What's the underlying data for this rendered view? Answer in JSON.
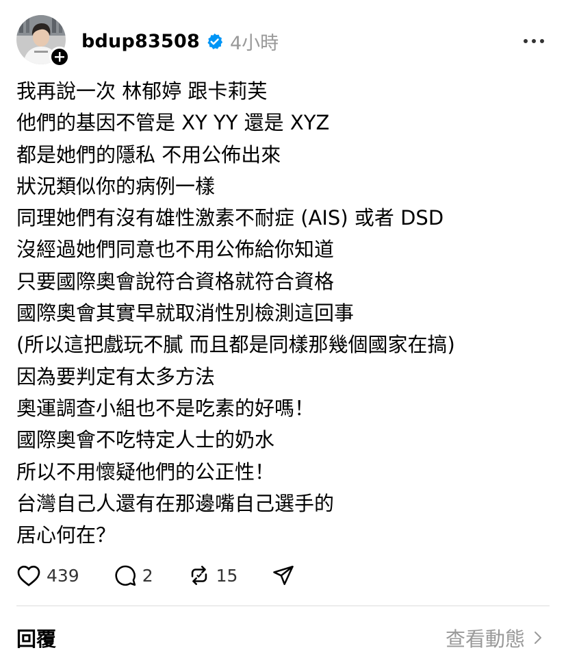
{
  "post": {
    "username": "bdup83508",
    "time": "4小時",
    "verified": true,
    "icons": {
      "avatar": "avatar",
      "follow": "plus-icon",
      "verified": "verified-badge-icon",
      "more": "more-horizontal-icon"
    },
    "lines": [
      "我再說一次 林郁婷 跟卡莉芙",
      "他們的基因不管是 XY YY 還是 XYZ",
      "都是她們的隱私 不用公佈出來",
      "狀況類似你的病例一樣",
      "同理她們有沒有雄性激素不耐症 (AIS) 或者 DSD",
      "沒經過她們同意也不用公佈給你知道",
      "只要國際奧會說符合資格就符合資格",
      "國際奧會其實早就取消性別檢測這回事",
      "(所以這把戲玩不膩 而且都是同樣那幾個國家在搞)",
      "因為要判定有太多方法",
      "奧運調查小組也不是吃素的好嗎！",
      "國際奧會不吃特定人士的奶水",
      "所以不用懷疑他們的公正性！",
      "台灣自己人還有在那邊嘴自己選手的",
      "居心何在？"
    ],
    "actions": {
      "likes": "439",
      "replies": "2",
      "reposts": "15"
    }
  },
  "footer": {
    "replies_label": "回覆",
    "view_activity": "查看動態"
  },
  "colors": {
    "text": "#000000",
    "muted": "#999999",
    "verified": "#0095f6",
    "divider": "#dddddd"
  }
}
